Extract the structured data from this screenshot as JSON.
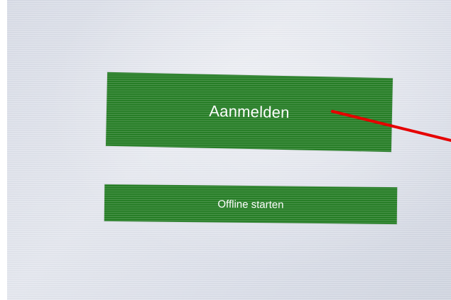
{
  "buttons": {
    "sign_in_label": "Aanmelden",
    "offline_label": "Offline starten"
  },
  "colors": {
    "button_green": "#1f7a1f",
    "annotation_red": "#e60000"
  }
}
